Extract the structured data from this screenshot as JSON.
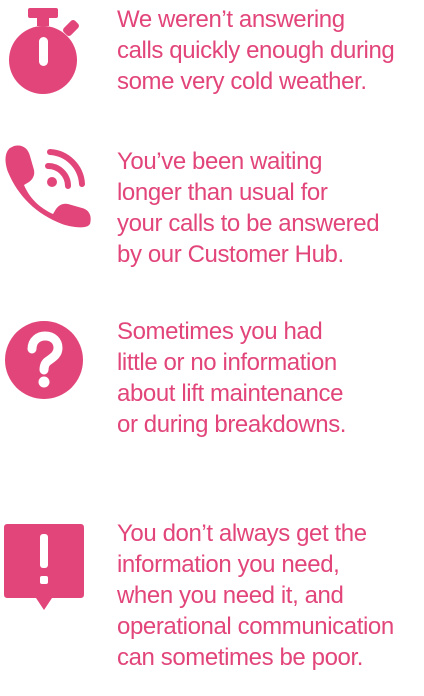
{
  "colors": {
    "accent": "#e2457a",
    "text": "#e2457a",
    "background": "#ffffff"
  },
  "items": [
    {
      "icon": "stopwatch-icon",
      "text": "We weren’t answering\ncalls quickly enough during\nsome very cold weather."
    },
    {
      "icon": "phone-ringing-icon",
      "text": "You’ve been waiting\nlonger than usual for\nyour calls to be answered\nby our Customer Hub."
    },
    {
      "icon": "question-mark-icon",
      "text": "Sometimes you had\nlittle or no information\nabout lift maintenance\nor during breakdowns."
    },
    {
      "icon": "exclamation-speech-bubble-icon",
      "text": "You don’t always get the\ninformation you need,\nwhen you need it, and\noperational communication\ncan sometimes be poor."
    }
  ]
}
